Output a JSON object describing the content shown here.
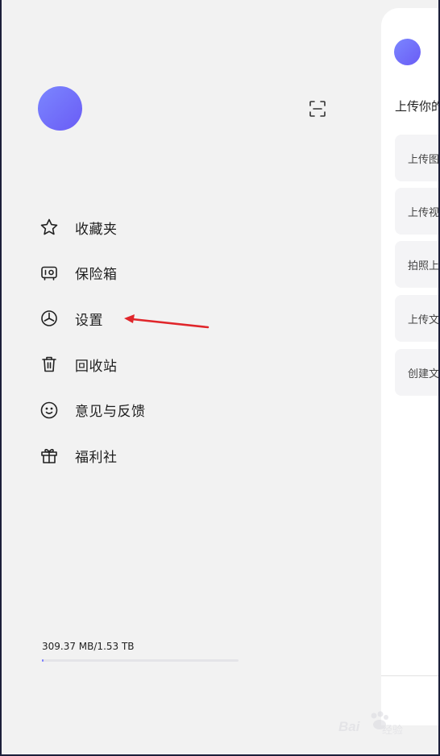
{
  "drawer": {
    "menu": [
      {
        "label": "收藏夹",
        "icon": "star-icon"
      },
      {
        "label": "保险箱",
        "icon": "safe-icon"
      },
      {
        "label": "设置",
        "icon": "settings-icon"
      },
      {
        "label": "回收站",
        "icon": "trash-icon"
      },
      {
        "label": "意见与反馈",
        "icon": "smiley-icon"
      },
      {
        "label": "福利社",
        "icon": "gift-icon"
      }
    ],
    "storage": {
      "text": "309.37 MB/1.53 TB",
      "used_fraction": 0.0002
    }
  },
  "panel": {
    "title": "上传你的",
    "cards": [
      {
        "label": "上传图片"
      },
      {
        "label": "上传视频"
      },
      {
        "label": "拍照上传"
      },
      {
        "label": "上传文件"
      },
      {
        "label": "创建文件夹"
      }
    ]
  },
  "watermark": {
    "brand": "Bai",
    "sub": "经验"
  },
  "colors": {
    "accent": "#6f73ff",
    "annotation": "#e0262b",
    "drawer_bg": "#f2f2f2",
    "frame": "#1c1f3a"
  }
}
